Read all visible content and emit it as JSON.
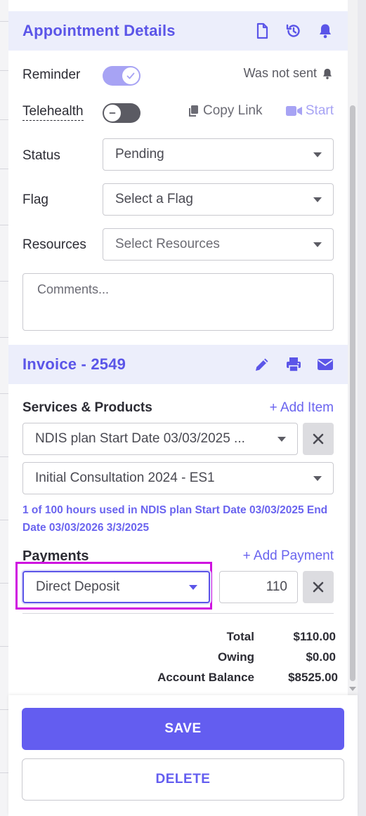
{
  "appointment": {
    "title": "Appointment Details",
    "reminder_label": "Reminder",
    "reminder_on": true,
    "reminder_status": "Was not sent",
    "telehealth_label": "Telehealth",
    "telehealth_on": false,
    "copy_link": "Copy Link",
    "start": "Start",
    "status_label": "Status",
    "status_value": "Pending",
    "flag_label": "Flag",
    "flag_placeholder": "Select a Flag",
    "resources_label": "Resources",
    "resources_placeholder": "Select Resources",
    "comments_placeholder": "Comments..."
  },
  "invoice": {
    "title": "Invoice - 2549",
    "services_label": "Services & Products",
    "add_item": "+ Add Item",
    "service_1": "NDIS plan Start Date 03/03/2025 ...",
    "service_2": "Initial Consultation 2024 - ES1",
    "note": "1 of 100 hours used in NDIS plan Start Date 03/03/2025 End Date 03/03/2026 3/3/2025",
    "payments_label": "Payments",
    "add_payment": "+ Add Payment",
    "payment_method": "Direct Deposit",
    "payment_amount": "110",
    "total_label": "Total",
    "total_value": "$110.00",
    "owing_label": "Owing",
    "owing_value": "$0.00",
    "balance_label": "Account Balance",
    "balance_value": "$8525.00"
  },
  "footer": {
    "save": "SAVE",
    "delete": "DELETE"
  },
  "colors": {
    "accent": "#5b55e8",
    "highlight": "#cf12e0"
  }
}
